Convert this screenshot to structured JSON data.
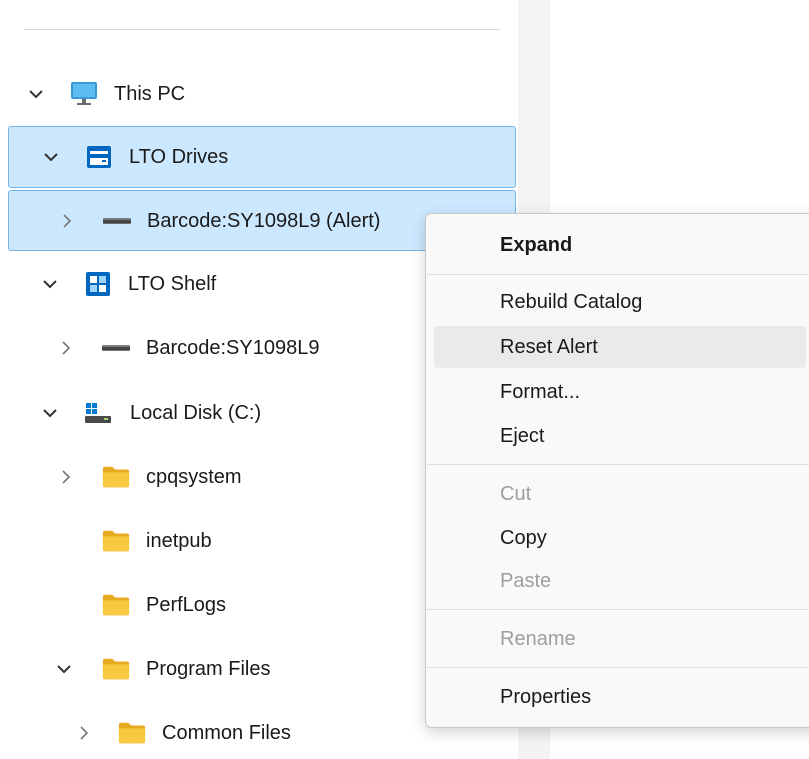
{
  "tree": {
    "items": [
      {
        "label": "This PC",
        "icon": "monitor-icon",
        "expanded": true,
        "selected": false
      },
      {
        "label": "LTO Drives",
        "icon": "lto-drive-icon",
        "expanded": true,
        "selected": true
      },
      {
        "label": "Barcode:SY1098L9 (Alert)",
        "icon": "tape-icon",
        "expanded": false,
        "selected": true
      },
      {
        "label": "LTO Shelf",
        "icon": "lto-shelf-icon",
        "expanded": true,
        "selected": false
      },
      {
        "label": "Barcode:SY1098L9",
        "icon": "tape-icon",
        "expanded": false,
        "selected": false
      },
      {
        "label": "Local Disk (C:)",
        "icon": "local-disk-icon",
        "expanded": true,
        "selected": false
      },
      {
        "label": "cpqsystem",
        "icon": "folder-icon",
        "expanded": false,
        "selected": false
      },
      {
        "label": "inetpub",
        "icon": "folder-icon",
        "selected": false
      },
      {
        "label": "PerfLogs",
        "icon": "folder-icon",
        "selected": false
      },
      {
        "label": "Program Files",
        "icon": "folder-icon",
        "expanded": true,
        "selected": false
      },
      {
        "label": "Common Files",
        "icon": "folder-icon",
        "expanded": false,
        "selected": false
      }
    ]
  },
  "context_menu": {
    "items": [
      {
        "label": "Expand",
        "bold": true,
        "enabled": true
      },
      {
        "label": "Rebuild Catalog",
        "enabled": true
      },
      {
        "label": "Reset Alert",
        "enabled": true,
        "hovered": true
      },
      {
        "label": "Format...",
        "enabled": true
      },
      {
        "label": "Eject",
        "enabled": true
      },
      {
        "label": "Cut",
        "enabled": false
      },
      {
        "label": "Copy",
        "enabled": true
      },
      {
        "label": "Paste",
        "enabled": false
      },
      {
        "label": "Rename",
        "enabled": false
      },
      {
        "label": "Properties",
        "enabled": true
      }
    ]
  },
  "colors": {
    "selection_bg": "#cce8ff",
    "selection_border": "#75b5ea",
    "folder": "#f8c83f",
    "accent": "#0067c0",
    "disabled_text": "#9e9e9e"
  }
}
